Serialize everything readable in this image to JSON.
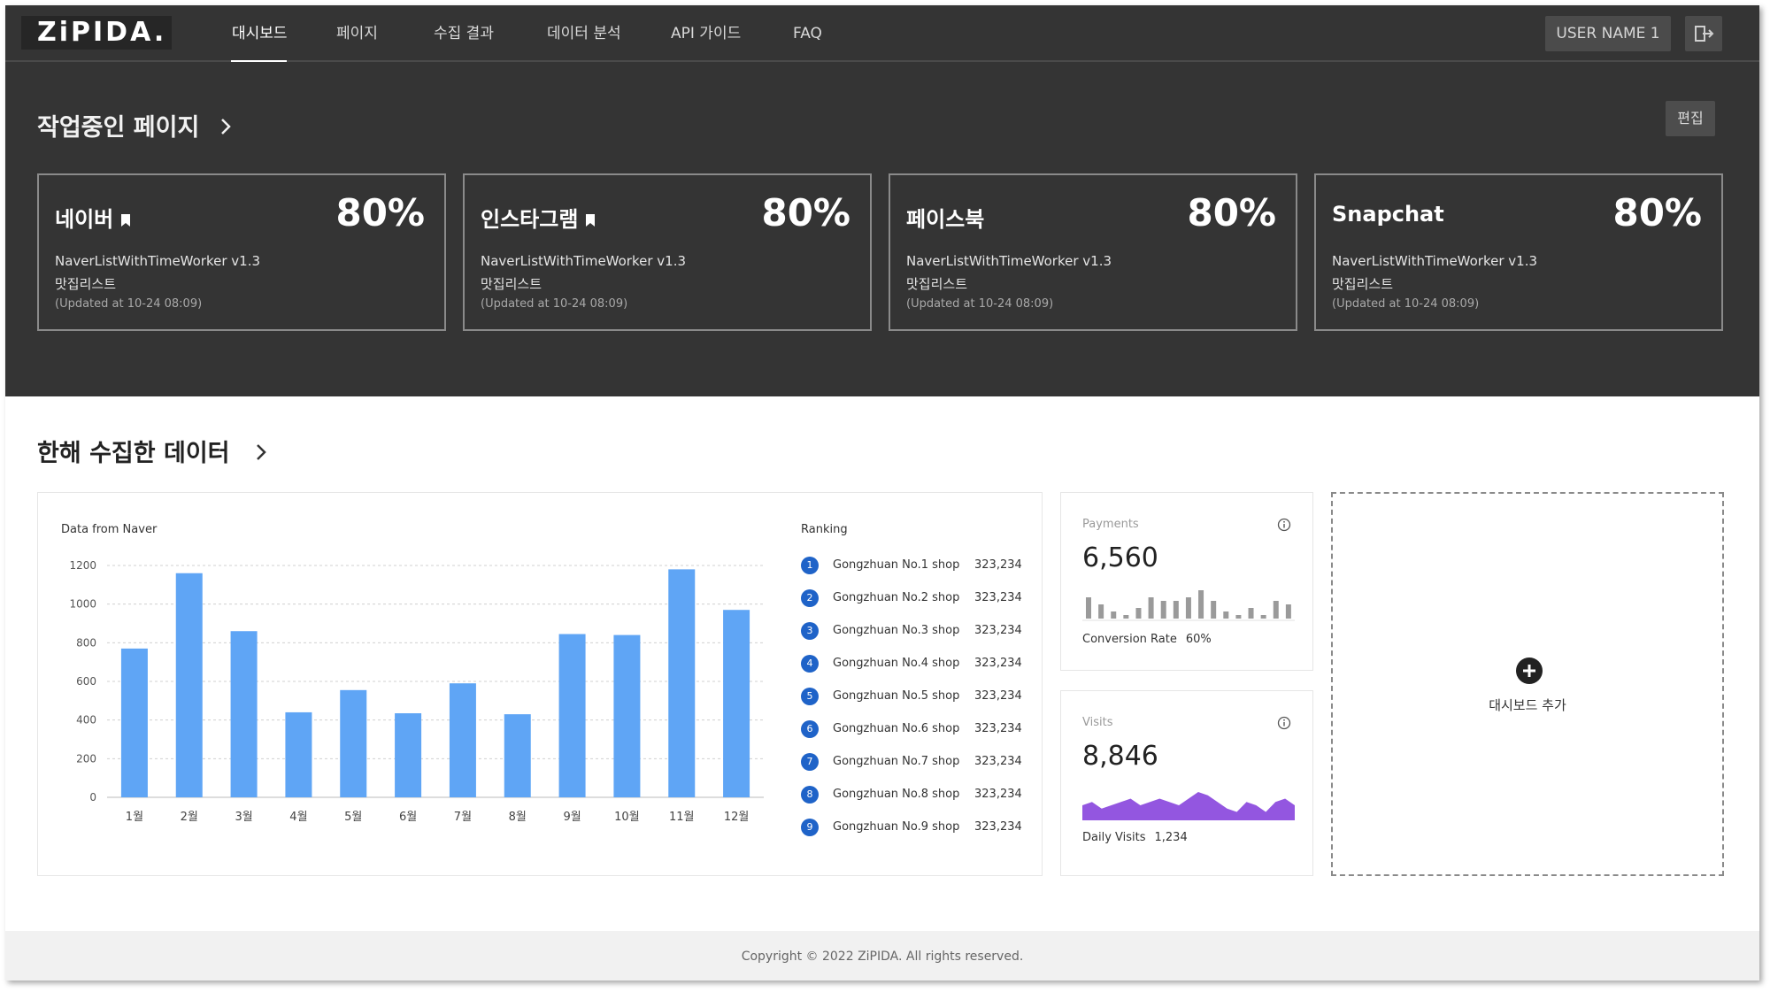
{
  "app": {
    "logo": "ZiPIDA."
  },
  "nav": {
    "items": [
      {
        "label": "대시보드",
        "active": true
      },
      {
        "label": "페이지",
        "active": false
      },
      {
        "label": "수집 결과",
        "active": false
      },
      {
        "label": "데이터 분석",
        "active": false
      },
      {
        "label": "API 가이드",
        "active": false
      },
      {
        "label": "FAQ",
        "active": false
      }
    ],
    "user_label": "USER NAME 1",
    "logout_icon": "logout-icon"
  },
  "work": {
    "title": "작업중인 페이지",
    "edit_label": "편집",
    "cards": [
      {
        "name": "네이버",
        "bookmarked": true,
        "percent": "80%",
        "worker": "NaverListWithTimeWorker v1.3",
        "list": "맛집리스트",
        "updated": "(Updated at 10-24  08:09)"
      },
      {
        "name": "인스타그램",
        "bookmarked": true,
        "percent": "80%",
        "worker": "NaverListWithTimeWorker v1.3",
        "list": "맛집리스트",
        "updated": "(Updated at 10-24  08:09)"
      },
      {
        "name": "페이스북",
        "bookmarked": false,
        "percent": "80%",
        "worker": "NaverListWithTimeWorker v1.3",
        "list": "맛집리스트",
        "updated": "(Updated at 10-24  08:09)"
      },
      {
        "name": "Snapchat",
        "bookmarked": false,
        "percent": "80%",
        "worker": "NaverListWithTimeWorker v1.3",
        "list": "맛집리스트",
        "updated": "(Updated at 10-24  08:09)"
      }
    ]
  },
  "data_section": {
    "title": "한해 수집한 데이터",
    "chart_caption": "Data from Naver",
    "ranking_title": "Ranking",
    "ranking": [
      {
        "rank": "1",
        "shop": "Gongzhuan No.1 shop",
        "value": "323,234"
      },
      {
        "rank": "2",
        "shop": "Gongzhuan No.2 shop",
        "value": "323,234"
      },
      {
        "rank": "3",
        "shop": "Gongzhuan No.3 shop",
        "value": "323,234"
      },
      {
        "rank": "4",
        "shop": "Gongzhuan No.4 shop",
        "value": "323,234"
      },
      {
        "rank": "5",
        "shop": "Gongzhuan No.5 shop",
        "value": "323,234"
      },
      {
        "rank": "6",
        "shop": "Gongzhuan No.6 shop",
        "value": "323,234"
      },
      {
        "rank": "7",
        "shop": "Gongzhuan No.7 shop",
        "value": "323,234"
      },
      {
        "rank": "8",
        "shop": "Gongzhuan No.8 shop",
        "value": "323,234"
      },
      {
        "rank": "9",
        "shop": "Gongzhuan No.9 shop",
        "value": "323,234"
      }
    ],
    "payments": {
      "label": "Payments",
      "value": "6,560",
      "foot_label": "Conversion Rate",
      "foot_value": "60%",
      "bars": [
        6,
        4,
        2,
        1,
        3,
        6,
        5,
        5,
        6,
        8,
        5,
        2,
        1,
        3,
        1,
        5,
        4
      ]
    },
    "visits": {
      "label": "Visits",
      "value": "8,846",
      "foot_label": "Daily Visits",
      "foot_value": "1,234",
      "area": [
        4,
        5,
        3,
        4,
        5,
        6,
        4,
        5,
        6,
        5,
        4,
        6,
        8,
        7,
        5,
        3,
        2,
        5,
        4,
        2,
        5,
        6,
        4
      ]
    },
    "add_label": "대시보드 추가"
  },
  "footer": {
    "copyright": "Copyright © 2022 ZiPIDA. All rights reserved."
  },
  "colors": {
    "dark_bg": "#343434",
    "bar": "#5fa5f5",
    "rank_badge": "#1f63c8",
    "visits_area": "#9356e0",
    "payments_bar": "#9a9a9a"
  },
  "chart_data": {
    "type": "bar",
    "title": "Data from Naver",
    "categories": [
      "1월",
      "2월",
      "3월",
      "4월",
      "5월",
      "6월",
      "7월",
      "8월",
      "9월",
      "10월",
      "11월",
      "12월"
    ],
    "values": [
      770,
      1160,
      860,
      440,
      555,
      435,
      590,
      430,
      845,
      840,
      1180,
      970
    ],
    "ylim": [
      0,
      1200
    ],
    "yticks": [
      0,
      200,
      400,
      600,
      800,
      1000,
      1200
    ],
    "grid": true
  }
}
